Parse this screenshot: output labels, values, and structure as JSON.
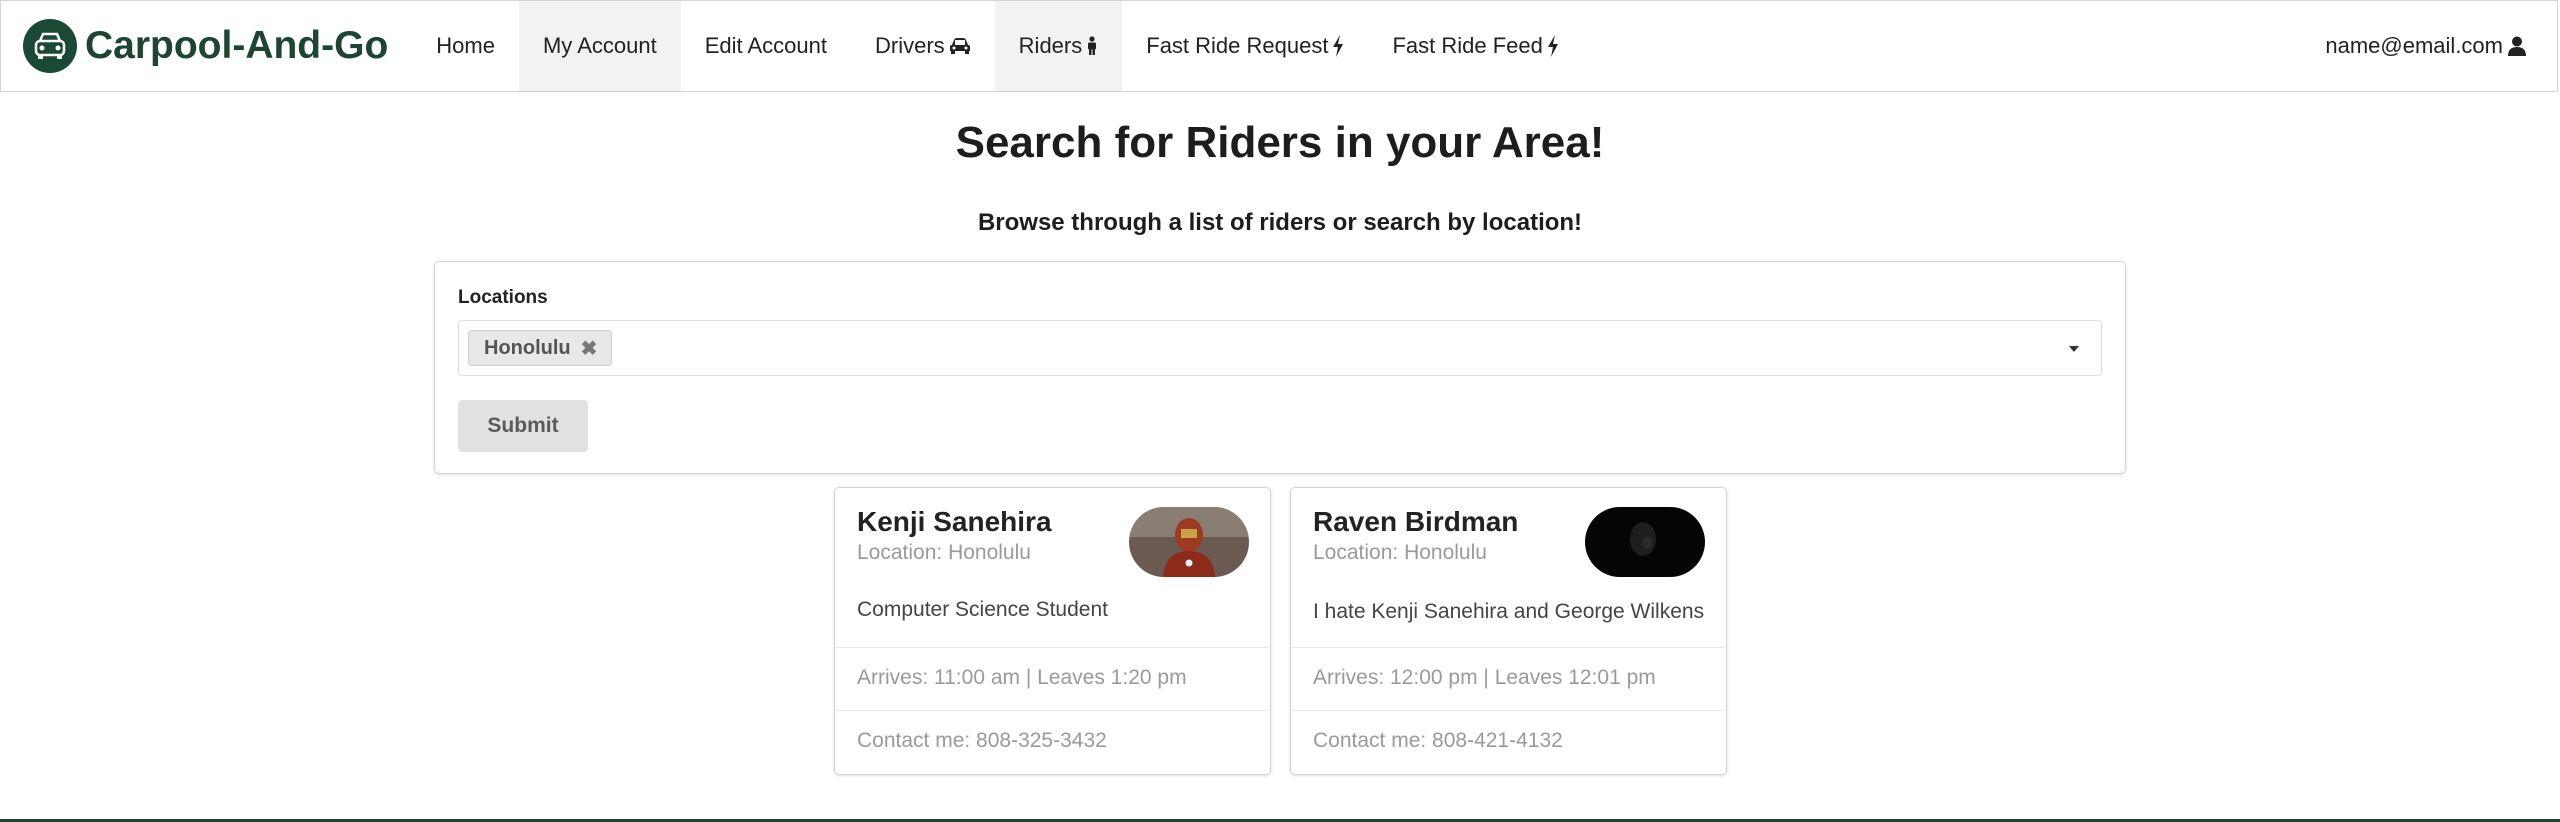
{
  "nav": {
    "brand": "Carpool-And-Go",
    "items": [
      {
        "label": "Home",
        "active": false,
        "icon": ""
      },
      {
        "label": "My Account",
        "active": true,
        "icon": ""
      },
      {
        "label": "Edit Account",
        "active": false,
        "icon": ""
      },
      {
        "label": "Drivers",
        "active": false,
        "icon": "car-icon"
      },
      {
        "label": "Riders",
        "active": true,
        "icon": "person-icon"
      },
      {
        "label": "Fast Ride Request",
        "active": false,
        "icon": "lightning-icon"
      },
      {
        "label": "Fast Ride Feed",
        "active": false,
        "icon": "lightning-icon"
      }
    ],
    "user_email": "name@email.com"
  },
  "page": {
    "title": "Search for Riders in your Area!",
    "subtitle": "Browse through a list of riders or search by location!"
  },
  "form": {
    "locations_label": "Locations",
    "selected_location": "Honolulu",
    "submit_label": "Submit"
  },
  "cards": [
    {
      "name": "Kenji Sanehira",
      "location": "Location: Honolulu",
      "description": "Computer Science Student",
      "times": "Arrives: 11:00 am | Leaves 1:20 pm",
      "contact": "Contact me: 808-325-3432"
    },
    {
      "name": "Raven Birdman",
      "location": "Location: Honolulu",
      "description": "I hate Kenji Sanehira and George Wilkens",
      "times": "Arrives: 12:00 pm | Leaves 12:01 pm",
      "contact": "Contact me: 808-421-4132"
    }
  ],
  "colors": {
    "brand": "#1c4532",
    "active_nav_bg": "#f2f2f2",
    "muted_text": "#9a9a9a"
  }
}
